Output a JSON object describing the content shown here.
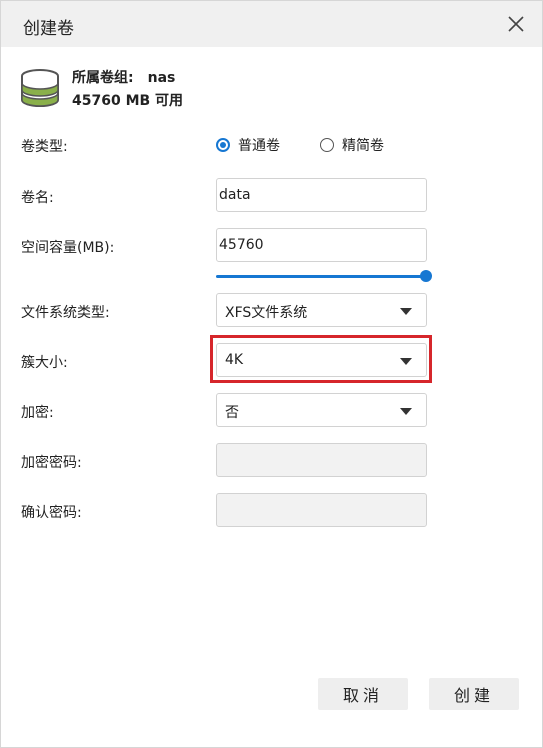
{
  "dialog": {
    "title": "创建卷"
  },
  "volume_group": {
    "label": "所属卷组:",
    "name": "nas",
    "available": "45760 MB 可用"
  },
  "form": {
    "volume_type": {
      "label": "卷类型:",
      "options": [
        "普通卷",
        "精简卷"
      ],
      "selected": "普通卷"
    },
    "volume_name": {
      "label": "卷名:",
      "value": "data"
    },
    "capacity": {
      "label": "空间容量(MB):",
      "value": "45760",
      "slider_fraction": 1.0
    },
    "filesystem": {
      "label": "文件系统类型:",
      "value": "XFS文件系统"
    },
    "cluster_size": {
      "label": "簇大小:",
      "value": "4K"
    },
    "encryption": {
      "label": "加密:",
      "value": "否"
    },
    "encryption_password": {
      "label": "加密密码:",
      "value": ""
    },
    "confirm_password": {
      "label": "确认密码:",
      "value": ""
    }
  },
  "buttons": {
    "cancel": "取消",
    "create": "创建"
  },
  "colors": {
    "accent": "#1677d2",
    "highlight_border": "#d6262b",
    "titlebar_bg": "#f0f0f0"
  }
}
